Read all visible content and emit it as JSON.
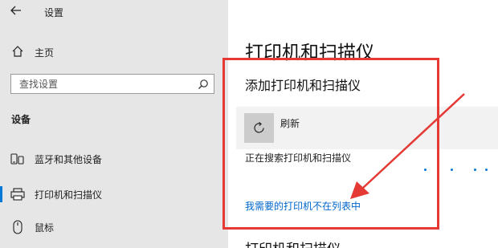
{
  "app": {
    "title": "设置",
    "back_icon": "back-arrow-icon"
  },
  "sidebar": {
    "home_label": "主页",
    "search_placeholder": "查找设置",
    "section": "设备",
    "items": [
      {
        "label": "蓝牙和其他设备",
        "icon": "bluetooth-devices-icon",
        "selected": false
      },
      {
        "label": "打印机和扫描仪",
        "icon": "printer-icon",
        "selected": true
      },
      {
        "label": "鼠标",
        "icon": "mouse-icon",
        "selected": false
      }
    ]
  },
  "main": {
    "title": "打印机和扫描仪",
    "add_heading": "添加打印机和扫描仪",
    "refresh_label": "刷新",
    "searching_text": "正在搜索打印机和扫描仪",
    "link_text": "我需要的打印机不在列表中",
    "next_heading": "打印机和扫描仪"
  },
  "colors": {
    "accent": "#0078d7",
    "annotation": "#e53935",
    "link": "#0066cc",
    "sidebar_bg": "#e6e6e6"
  }
}
